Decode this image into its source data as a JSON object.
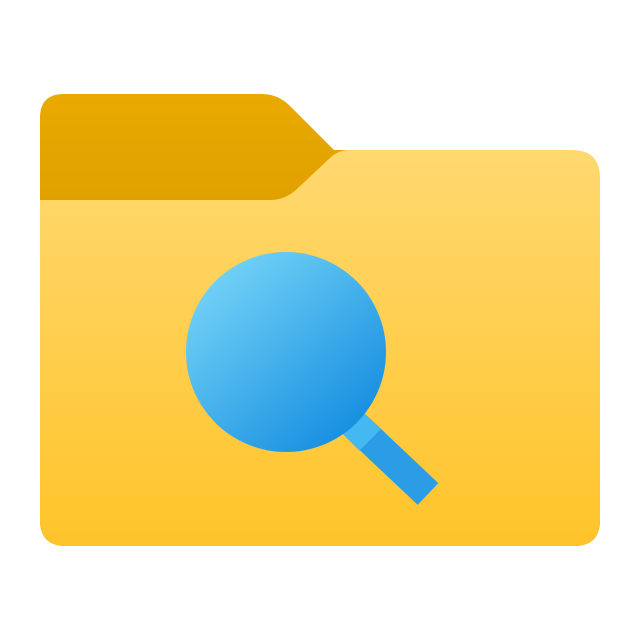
{
  "icon": {
    "name": "folder-search-icon",
    "parts": [
      "folder-back-tab",
      "folder-front-body",
      "magnifier-lens",
      "magnifier-handle"
    ]
  },
  "colors": {
    "background": "#ffffff",
    "folder_tab_top": "#e9a900",
    "folder_tab_bottom": "#c48700",
    "folder_body_top": "#ffd870",
    "folder_body_bottom": "#ffc42a",
    "lens_light": "#72d2f6",
    "lens_dark": "#168ee0",
    "handle": "#2b9de6",
    "handle_collar": "#44b8f0"
  }
}
